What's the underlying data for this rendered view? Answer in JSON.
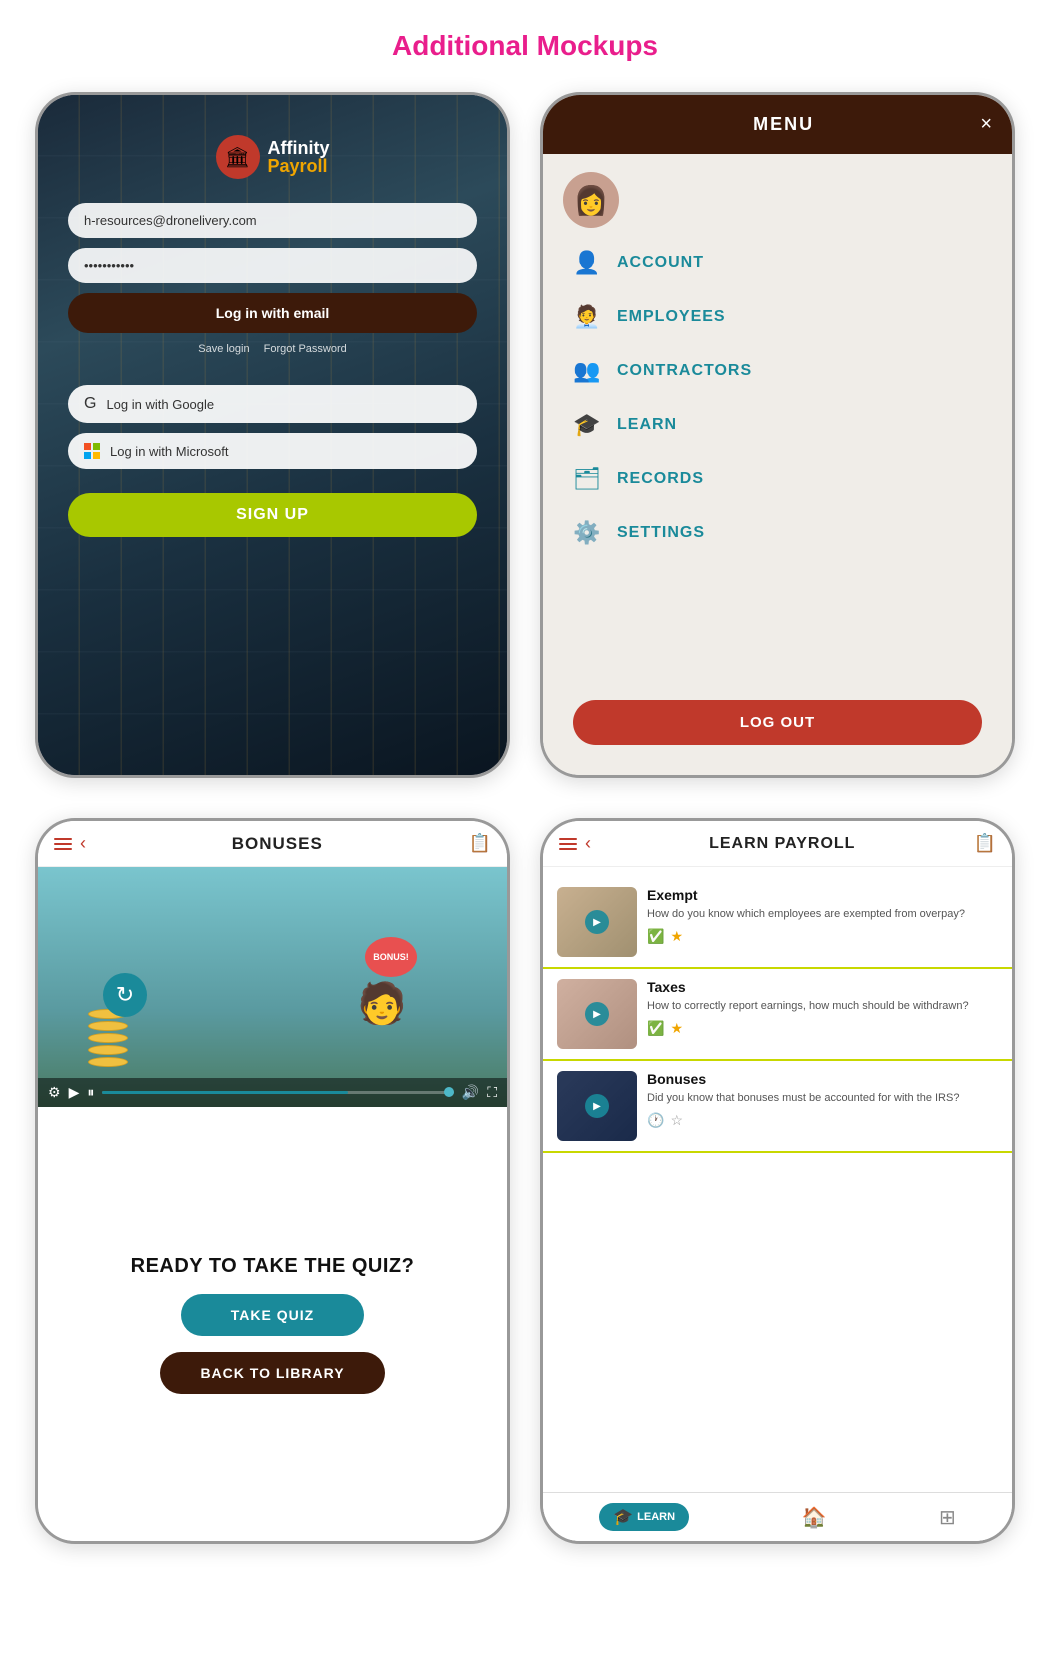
{
  "page": {
    "title": "Additional Mockups",
    "title_color": "#e91e8c"
  },
  "phone1": {
    "logo_affinity": "Affinity",
    "logo_payroll": "Payroll",
    "email_placeholder": "h-resources@dronelivery.com",
    "email_value": "h-resources@dronelivery.com",
    "password_value": "***********",
    "btn_email_login": "Log in with email",
    "save_login": "Save login",
    "forgot_password": "Forgot Password",
    "btn_google": "Log in with Google",
    "btn_microsoft": "Log in with Microsoft",
    "btn_signup": "SIGN UP"
  },
  "phone2": {
    "menu_title": "MENU",
    "close_label": "×",
    "items": [
      {
        "label": "ACCOUNT",
        "icon": "person"
      },
      {
        "label": "EMPLOYEES",
        "icon": "employees"
      },
      {
        "label": "CONTRACTORS",
        "icon": "contractors"
      },
      {
        "label": "LEARN",
        "icon": "learn"
      },
      {
        "label": "RECORDS",
        "icon": "records"
      },
      {
        "label": "SETTINGS",
        "icon": "settings"
      }
    ],
    "btn_logout": "LOG OUT"
  },
  "phone3": {
    "title": "BONUSES",
    "balloon_text": "BONUS!",
    "quiz_title": "READY TO TAKE THE QUIZ?",
    "btn_take_quiz": "TAKE QUIZ",
    "btn_back_library": "BACK TO LIBRARY"
  },
  "phone4": {
    "title": "LEARN PAYROLL",
    "items": [
      {
        "title": "Exempt",
        "description": "How do you know which employees are exempted from overpay?",
        "checked": true,
        "starred": true,
        "thumb_type": "exempt"
      },
      {
        "title": "Taxes",
        "description": "How to correctly report earnings, how much should be withdrawn?",
        "checked": true,
        "starred": true,
        "thumb_type": "taxes"
      },
      {
        "title": "Bonuses",
        "description": "Did you know that bonuses must be accounted for with the IRS?",
        "checked": false,
        "starred": false,
        "thumb_type": "bonuses"
      }
    ],
    "nav_learn": "LEARN",
    "nav_home": "🏠",
    "nav_grid": "⊞"
  }
}
